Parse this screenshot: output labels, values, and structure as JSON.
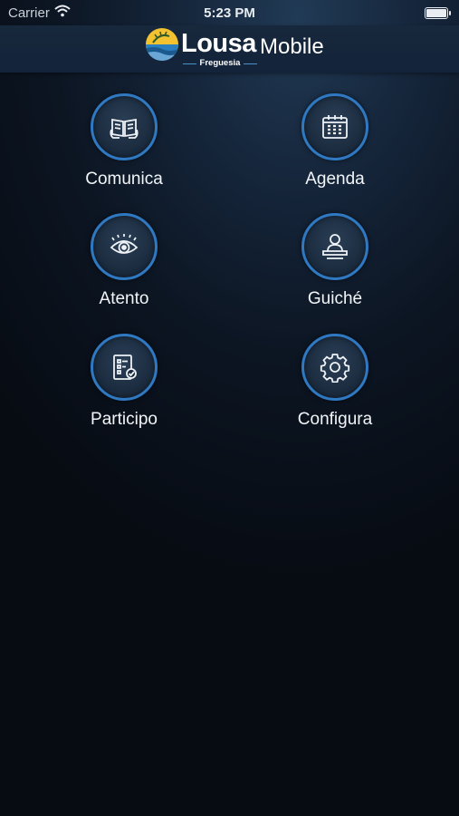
{
  "status_bar": {
    "carrier": "Carrier",
    "time": "5:23 PM"
  },
  "header": {
    "logo_main": "Lousa",
    "logo_sub": "Mobile",
    "logo_tag": "Freguesia"
  },
  "menu": [
    {
      "label": "Comunica",
      "icon": "open-book-icon"
    },
    {
      "label": "Agenda",
      "icon": "calendar-icon"
    },
    {
      "label": "Atento",
      "icon": "eye-icon"
    },
    {
      "label": "Guiché",
      "icon": "person-counter-icon"
    },
    {
      "label": "Participo",
      "icon": "checklist-icon"
    },
    {
      "label": "Configura",
      "icon": "gear-icon"
    }
  ],
  "colors": {
    "ring": "#2f78c2",
    "background": "#0c1522",
    "header": "#17283c"
  }
}
